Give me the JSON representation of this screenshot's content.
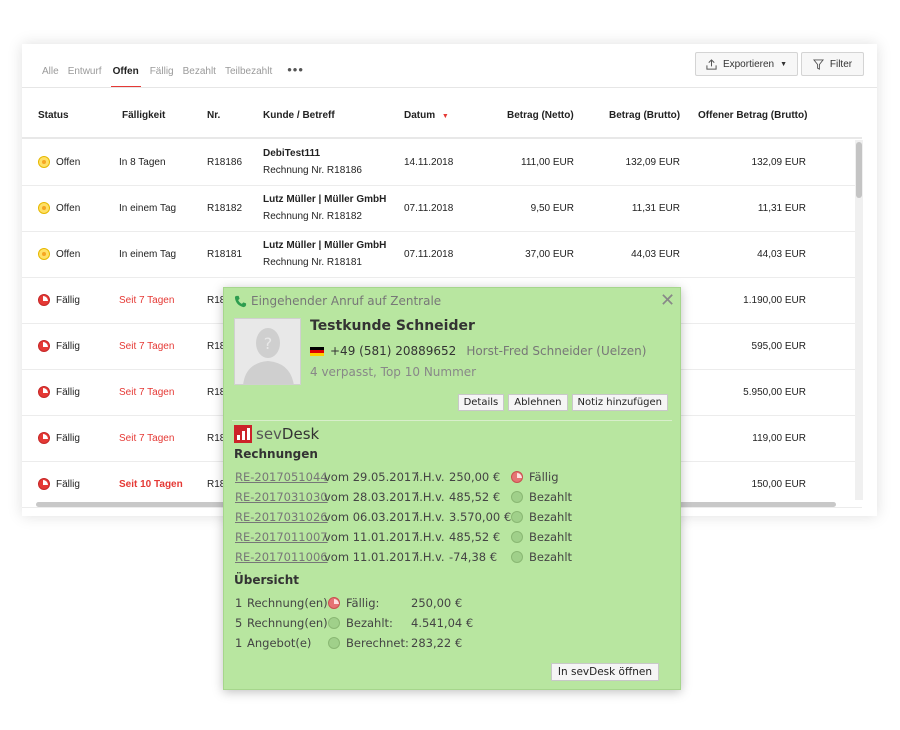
{
  "tabs": [
    "Alle",
    "Entwurf",
    "Offen",
    "Fällig",
    "Bezahlt",
    "Teilbezahlt"
  ],
  "active_tab": "Offen",
  "toolbar": {
    "export_label": "Exportieren",
    "filter_label": "Filter"
  },
  "columns": [
    "Status",
    "Fälligkeit",
    "Nr.",
    "Kunde / Betreff",
    "Datum",
    "Betrag (Netto)",
    "Betrag (Brutto)",
    "Offener Betrag (Brutto)"
  ],
  "rows": [
    {
      "status": "Offen",
      "due": "In 8 Tagen",
      "nr": "R18186",
      "customer": "DebiTest111",
      "subject": "Rechnung Nr. R18186",
      "date": "14.11.2018",
      "net": "111,00 EUR",
      "gross": "132,09 EUR",
      "open": "132,09 EUR"
    },
    {
      "status": "Offen",
      "due": "In einem Tag",
      "nr": "R18182",
      "customer": "Lutz Müller | Müller GmbH",
      "subject": "Rechnung Nr. R18182",
      "date": "07.11.2018",
      "net": "9,50 EUR",
      "gross": "11,31 EUR",
      "open": "11,31 EUR"
    },
    {
      "status": "Offen",
      "due": "In einem Tag",
      "nr": "R18181",
      "customer": "Lutz Müller | Müller GmbH",
      "subject": "Rechnung Nr. R18181",
      "date": "07.11.2018",
      "net": "37,00 EUR",
      "gross": "44,03 EUR",
      "open": "44,03 EUR"
    },
    {
      "status": "Fällig",
      "due": "Seit 7 Tagen",
      "nr": "R18",
      "open": "1.190,00 EUR"
    },
    {
      "status": "Fällig",
      "due": "Seit 7 Tagen",
      "nr": "R18",
      "open": "595,00 EUR"
    },
    {
      "status": "Fällig",
      "due": "Seit 7 Tagen",
      "nr": "R18",
      "open": "5.950,00 EUR"
    },
    {
      "status": "Fällig",
      "due": "Seit 7 Tagen",
      "nr": "R18",
      "open": "119,00 EUR"
    },
    {
      "status": "Fällig",
      "due": "Seit 10 Tagen",
      "nr": "R18",
      "open": "150,00 EUR"
    }
  ],
  "popup": {
    "title": "Eingehender Anruf auf Zentrale",
    "name": "Testkunde Schneider",
    "phone": "+49 (581) 20889652",
    "contact": "Horst-Fred Schneider  (Uelzen)",
    "missed": "4 verpasst, Top 10 Nummer",
    "btn_details": "Details",
    "btn_reject": "Ablehnen",
    "btn_note": "Notiz hinzufügen",
    "brand_a": "sev",
    "brand_b": "Desk",
    "invoices_title": "Rechnungen",
    "invoices": [
      {
        "id": "RE-2017051044",
        "date": "vom 29.05.2017",
        "ihv": "i.H.v.",
        "amount": "250,00 €",
        "status": "Fällig"
      },
      {
        "id": "RE-2017031030",
        "date": "vom 28.03.2017",
        "ihv": "i.H.v.",
        "amount": "485,52 €",
        "status": "Bezahlt"
      },
      {
        "id": "RE-2017031026",
        "date": "vom 06.03.2017",
        "ihv": "i.H.v.",
        "amount": "3.570,00 €",
        "status": "Bezahlt"
      },
      {
        "id": "RE-2017011007",
        "date": "vom 11.01.2017",
        "ihv": "i.H.v.",
        "amount": "485,52 €",
        "status": "Bezahlt"
      },
      {
        "id": "RE-2017011006",
        "date": "vom 11.01.2017",
        "ihv": "i.H.v.",
        "amount": "-74,38 €",
        "status": "Bezahlt"
      }
    ],
    "overview_title": "Übersicht",
    "overview": [
      {
        "count": "1",
        "kind": "Rechnung(en)",
        "label": "Fällig:",
        "amount": "250,00 €",
        "state": "due"
      },
      {
        "count": "5",
        "kind": "Rechnung(en)",
        "label": "Bezahlt:",
        "amount": "4.541,04 €",
        "state": "paid"
      },
      {
        "count": "1",
        "kind": "Angebot(e)",
        "label": "Berechnet:",
        "amount": "283,22 €",
        "state": "paid"
      }
    ],
    "open_button": "In sevDesk öffnen"
  }
}
